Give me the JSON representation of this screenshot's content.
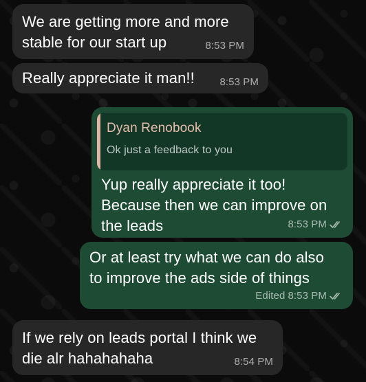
{
  "messages": [
    {
      "direction": "incoming",
      "text": "We are getting more and more\nstable for our start up",
      "time": "8:53 PM"
    },
    {
      "direction": "incoming",
      "text": "Really appreciate it man!!",
      "time": "8:53 PM"
    },
    {
      "direction": "outgoing",
      "reply": {
        "author": "Dyan Renobook",
        "text": "Ok just a feedback to you"
      },
      "text": "Yup really appreciate it too!\nBecause then we can improve on\nthe leads",
      "time": "8:53 PM",
      "status_icon": "double-check-icon"
    },
    {
      "direction": "outgoing",
      "text": "Or at least try what we can do also\nto improve the ads side of things",
      "edited_label": "Edited",
      "time": "8:53 PM",
      "status_icon": "double-check-icon"
    },
    {
      "direction": "incoming",
      "text": "If we rely on leads portal I think we\ndie alr hahahahaha",
      "time": "8:54 PM"
    }
  ],
  "colors": {
    "background": "#0b0b0b",
    "incoming_bubble": "#272727",
    "outgoing_bubble": "#1d4b34",
    "reply_bar": "#e0b8a6",
    "meta_text": "#a8a8a8"
  }
}
